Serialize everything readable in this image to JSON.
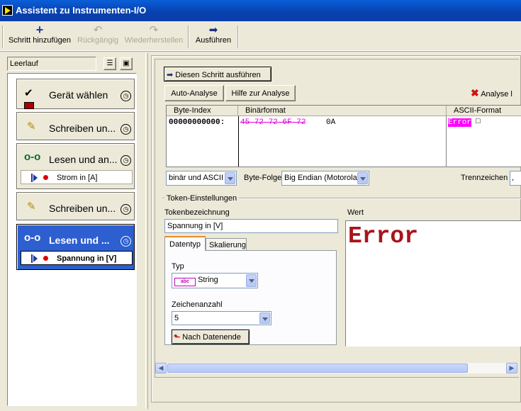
{
  "window": {
    "title": "Assistent zu Instrumenten-I/O"
  },
  "toolbar": {
    "add_step": "Schritt hinzufügen",
    "undo": "Rückgängig",
    "redo": "Wiederherstellen",
    "run": "Ausführen"
  },
  "sidebar": {
    "status": "Leerlauf",
    "steps": [
      {
        "label": "Gerät wählen",
        "icon": "instrument-icon"
      },
      {
        "label": "Schreiben un...",
        "icon": "pencil-icon"
      },
      {
        "label": "Lesen und an...",
        "icon": "glasses-icon",
        "token": "Strom in [A]"
      },
      {
        "label": "Schreiben un...",
        "icon": "pencil-icon"
      },
      {
        "label": "Lesen und ...",
        "icon": "glasses-icon",
        "token": "Spannung in [V]",
        "selected": true
      }
    ]
  },
  "main": {
    "run_step_button": "Diesen Schritt ausführen",
    "auto_analysis_button": "Auto-Analyse",
    "analysis_help_button": "Hilfe zur Analyse",
    "analysis_reset_button": "Analyse l",
    "table": {
      "headers": [
        "Byte-Index",
        "Binärformat",
        "ASCII-Format"
      ],
      "byte_index": "00000000000:",
      "binary_struck": "45 72 72 6F 72",
      "binary_rest": "0A",
      "ascii_highlight": "Error",
      "ascii_rest": "□"
    },
    "format_combo": "binär und ASCII",
    "byte_order_label": "Byte-Folge",
    "byte_order_combo": "Big Endian (Motorola)",
    "separator_label": "Trennzeichen",
    "separator_value": ","
  },
  "token": {
    "section_title": "Token-Einstellungen",
    "name_label": "Tokenbezeichnung",
    "name_value": "Spannung in [V]",
    "tabs": [
      "Datentyp",
      "Skalierung"
    ],
    "type_label": "Typ",
    "type_value": "String",
    "type_icon_text": "abc",
    "char_count_label": "Zeichenanzahl",
    "char_count_value": "5",
    "to_end_button": "Nach Datenende",
    "value_label": "Wert",
    "value_display": "Error"
  },
  "colors": {
    "highlight": "#ff00ff",
    "error_text": "#a8141a",
    "title_blue": "#0a50c8",
    "selected_step": "#2d5fd0"
  }
}
